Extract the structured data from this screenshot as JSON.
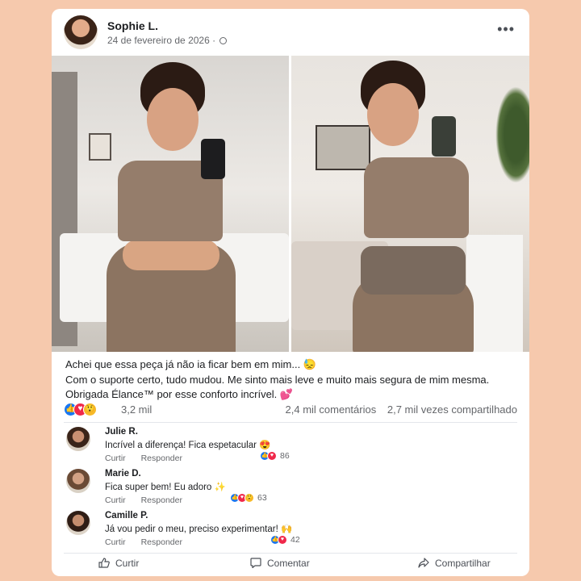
{
  "post": {
    "author": "Sophie L.",
    "date": "24 de fevereiro de 2026 ·",
    "caption_lines": [
      "Achei que essa peça já não ia ficar bem em mim... 😓",
      "Com o suporte certo, tudo mudou. Me sinto mais leve e muito mais segura de mim mesma.",
      "Obrigada Élance™ por esse conforto incrível. 💕"
    ],
    "reaction_count": "3,2 mil",
    "comments_count": "2,4 mil comentários",
    "shares_count": "2,7 mil vezes compartilhado"
  },
  "comments": [
    {
      "name": "Julie R.",
      "text": "Incrível a diferença! Fica espetacular 😍",
      "like": "Curtir",
      "reply": "Responder",
      "reactions": "86"
    },
    {
      "name": "Marie D.",
      "text": "Fica super bem! Eu adoro ✨",
      "like": "Curtir",
      "reply": "Responder",
      "reactions": "63"
    },
    {
      "name": "Camille P.",
      "text": "Já vou pedir o meu, preciso experimentar! 🙌",
      "like": "Curtir",
      "reply": "Responder",
      "reactions": "42"
    }
  ],
  "footer": {
    "like": "Curtir",
    "comment": "Comentar",
    "share": "Compartilhar"
  },
  "colors": {
    "background": "#f6c9ad",
    "like": "#1877f2",
    "love": "#f0284a",
    "wow": "#f7b928",
    "text": "#1c1e21",
    "muted": "#65676b"
  },
  "icons": [
    "globe-icon",
    "more-icon",
    "like-reaction-icon",
    "love-reaction-icon",
    "wow-reaction-icon",
    "thumbs-up-icon",
    "comment-icon",
    "share-icon"
  ]
}
